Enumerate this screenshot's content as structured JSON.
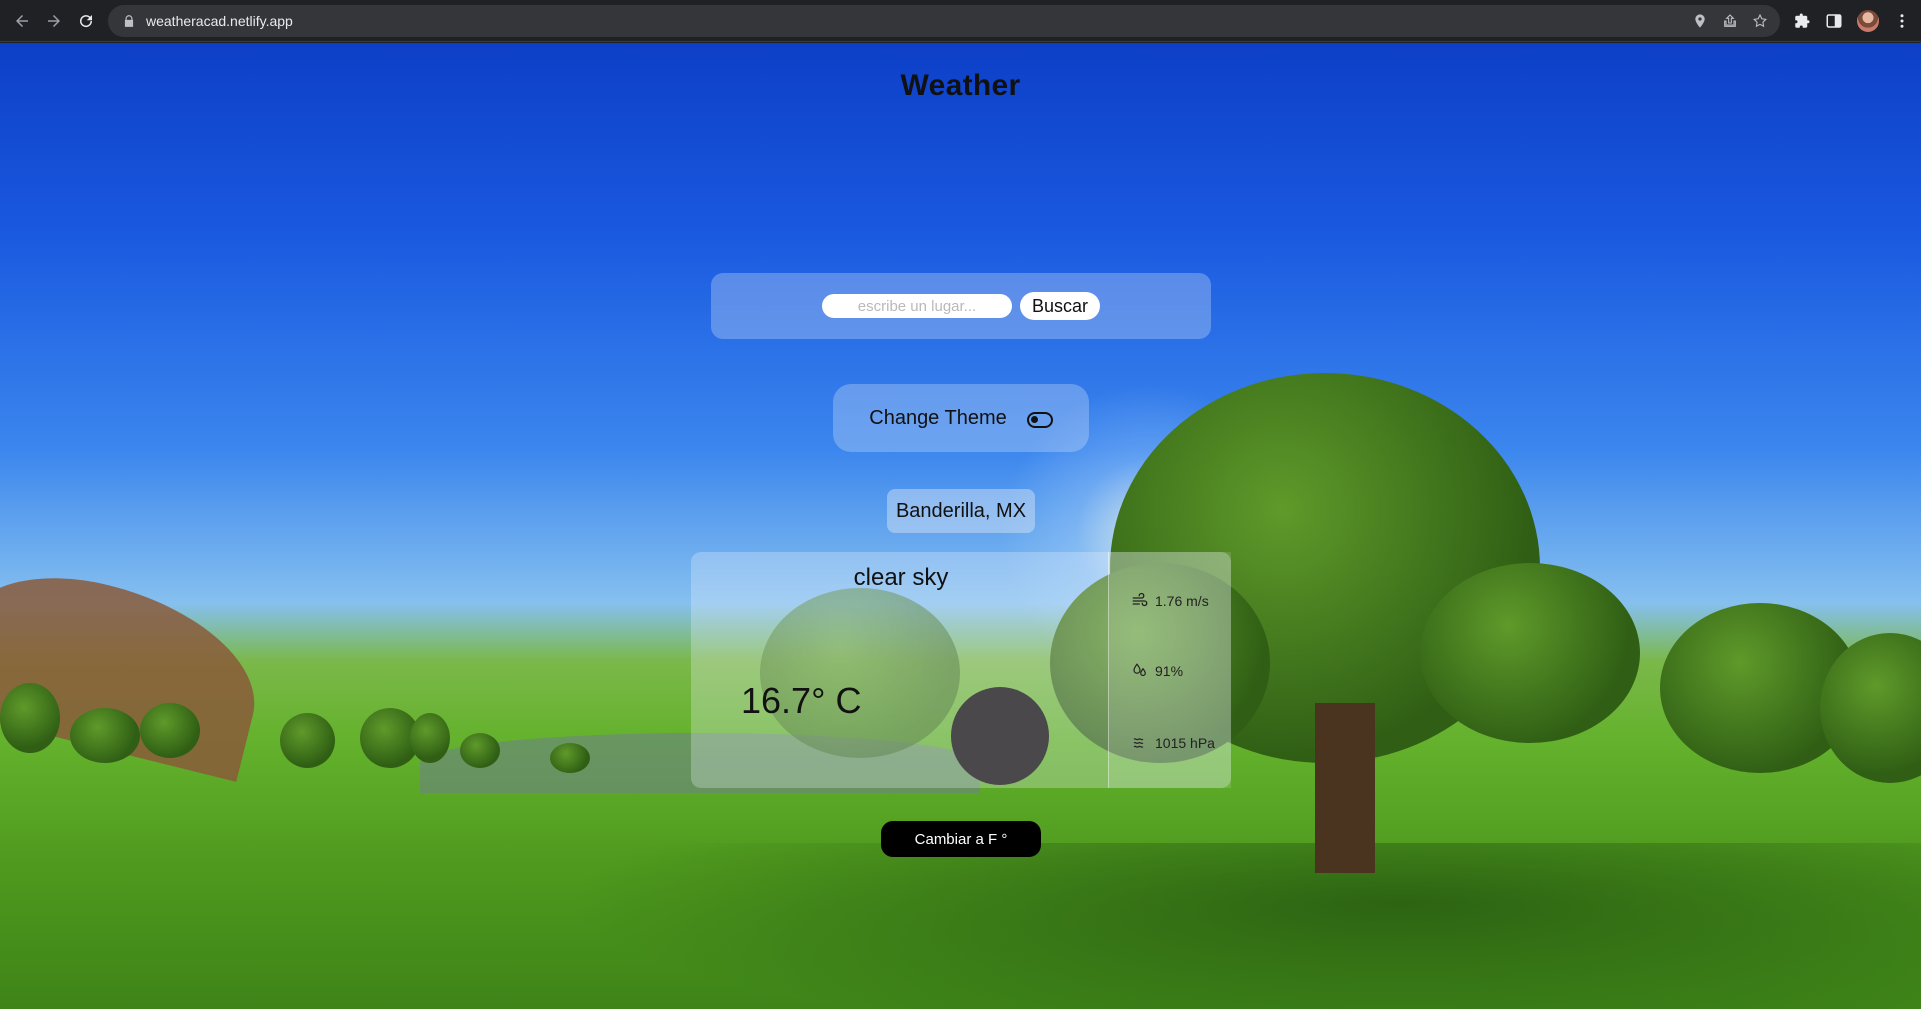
{
  "browser": {
    "url": "weatheracad.netlify.app"
  },
  "app": {
    "title": "Weather",
    "search": {
      "placeholder": "escribe un lugar...",
      "value": "",
      "button_label": "Buscar"
    },
    "theme": {
      "label": "Change Theme",
      "toggle_icon": "toggle-icon"
    },
    "location": "Banderilla, MX",
    "weather": {
      "description": "clear sky",
      "temperature": "16.7° C",
      "icon": "weather-icon",
      "wind": "1.76 m/s",
      "humidity": "91%",
      "pressure": "1015 hPa"
    },
    "unit_button_label": "Cambiar a F °"
  },
  "colors": {
    "sky": "#1a5ae0",
    "grass": "#64b22d",
    "panel": "rgba(210,225,245,0.33)",
    "button_dark": "#000000",
    "icon_circle": "#4a484b"
  }
}
